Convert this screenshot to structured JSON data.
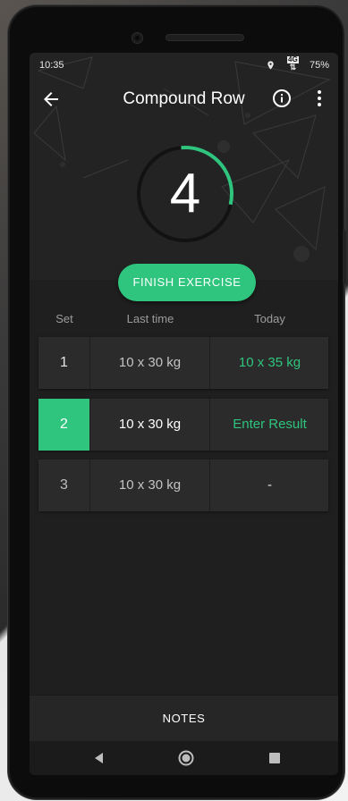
{
  "status": {
    "time": "10:35",
    "network": "4G",
    "battery": "75%"
  },
  "appbar": {
    "title": "Compound Row"
  },
  "timer": {
    "value": "4",
    "progress": 0.3
  },
  "actions": {
    "finish_label": "FINISH EXERCISE",
    "notes_label": "NOTES"
  },
  "table": {
    "headers": [
      "Set",
      "Last time",
      "Today"
    ],
    "rows": [
      {
        "set": "1",
        "last": "10 x 30 kg",
        "today": "10 x 35 kg"
      },
      {
        "set": "2",
        "last": "10 x 30 kg",
        "today": "Enter Result"
      },
      {
        "set": "3",
        "last": "10 x 30 kg",
        "today": "-"
      }
    ]
  },
  "colors": {
    "accent": "#2fc57e",
    "background": "#1f1f1f",
    "row": "#2b2b2b"
  },
  "icons": [
    "back-arrow-icon",
    "info-icon",
    "more-vert-icon",
    "location-icon",
    "nav-back-icon",
    "nav-home-icon",
    "nav-recents-icon"
  ]
}
